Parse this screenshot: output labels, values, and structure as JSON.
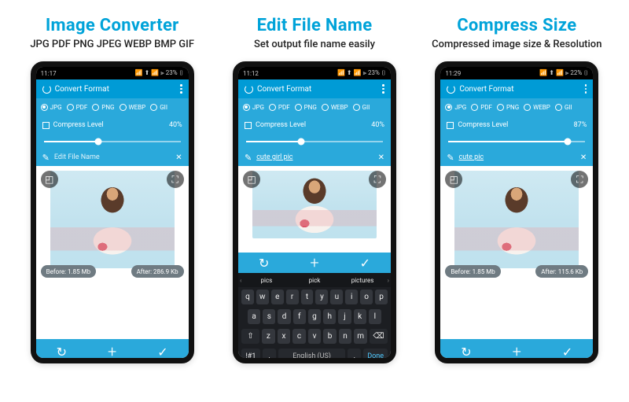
{
  "accent": "#00a3d9",
  "panels": [
    {
      "title": "Image Converter",
      "subtitle": "JPG PDF PNG JPEG WEBP BMP GIF",
      "status_time": "11:17",
      "status_right": "📶 ⬆ 📶 ⫸ 23% ▯",
      "app_title": "Convert Format",
      "formats": [
        "JPG",
        "PDF",
        "PNG",
        "WEBP",
        "GII"
      ],
      "selected_format": "JPG",
      "compress_label": "Compress Level",
      "compress_value": "40%",
      "slider_pct": 40,
      "filename_value": "Edit File Name",
      "filename_is_placeholder": true,
      "pill_before": "Before: 1.85 Mb",
      "pill_after": "After: 286.9 Kb",
      "show_pills": true,
      "show_keyboard": false,
      "show_fullbottom": true
    },
    {
      "title": "Edit File Name",
      "subtitle": "Set output file name easily",
      "status_time": "11:12",
      "status_right": "📶 ⬆ 📶 ⫸ 23% ▯",
      "app_title": "Convert Format",
      "formats": [
        "JPG",
        "PDF",
        "PNG",
        "WEBP",
        "GII"
      ],
      "selected_format": "JPG",
      "compress_label": "Compress Level",
      "compress_value": "40%",
      "slider_pct": 40,
      "filename_value": "cute girl pic",
      "filename_is_placeholder": false,
      "show_pills": false,
      "show_keyboard": true,
      "show_fullbottom": false,
      "keyboard": {
        "suggestions": [
          "pics",
          "pick",
          "pictures"
        ],
        "row1": [
          "q",
          "w",
          "e",
          "r",
          "t",
          "y",
          "u",
          "i",
          "o",
          "p"
        ],
        "row2": [
          "a",
          "s",
          "d",
          "f",
          "g",
          "h",
          "j",
          "k",
          "l"
        ],
        "row3_shift": "⇧",
        "row3": [
          "z",
          "x",
          "c",
          "v",
          "b",
          "n",
          "m"
        ],
        "row3_back": "⌫",
        "numsym": "!#1",
        "comma": ",",
        "space": "English (US)",
        "period": ".",
        "done": "Done"
      }
    },
    {
      "title": "Compress Size",
      "subtitle": "Compressed image size & Resolution",
      "status_time": "11:29",
      "status_right": "📶 ⬆ 📶 ⫸ 22% ▯",
      "app_title": "Convert Format",
      "formats": [
        "JPG",
        "PDF",
        "PNG",
        "WEBP",
        "GII"
      ],
      "selected_format": "JPG",
      "compress_label": "Compress Level",
      "compress_value": "87%",
      "slider_pct": 87,
      "filename_value": "cute pic",
      "filename_is_placeholder": false,
      "pill_before": "Before: 1.85 Mb",
      "pill_after": "After: 115.6 Kb",
      "show_pills": true,
      "show_keyboard": false,
      "show_fullbottom": true
    }
  ]
}
